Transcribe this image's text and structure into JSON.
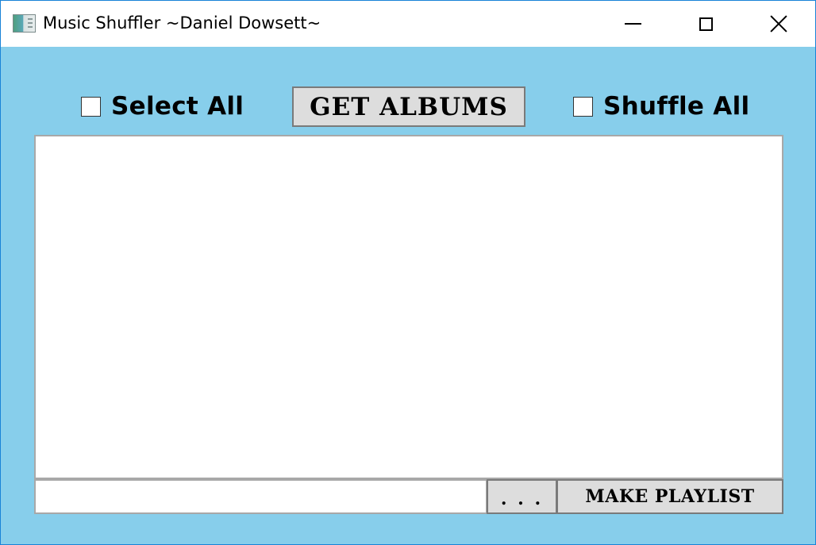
{
  "window": {
    "title": "Music Shuffler ~Daniel Dowsett~",
    "icon": "app-window-icon",
    "controls": {
      "minimize_icon": "minimize-icon",
      "maximize_icon": "maximize-icon",
      "close_icon": "close-icon"
    }
  },
  "colors": {
    "background": "#87ceeb",
    "button_face": "#dddddd",
    "titlebar_border": "#1883d7"
  },
  "toolbar": {
    "select_all": {
      "label": "Select All",
      "checked": false
    },
    "get_albums_label": "GET ALBUMS",
    "shuffle_all": {
      "label": "Shuffle All",
      "checked": false
    }
  },
  "album_list": {
    "items": []
  },
  "footer": {
    "path_value": "",
    "browse_label": ". . .",
    "make_playlist_label": "MAKE PLAYLIST"
  }
}
